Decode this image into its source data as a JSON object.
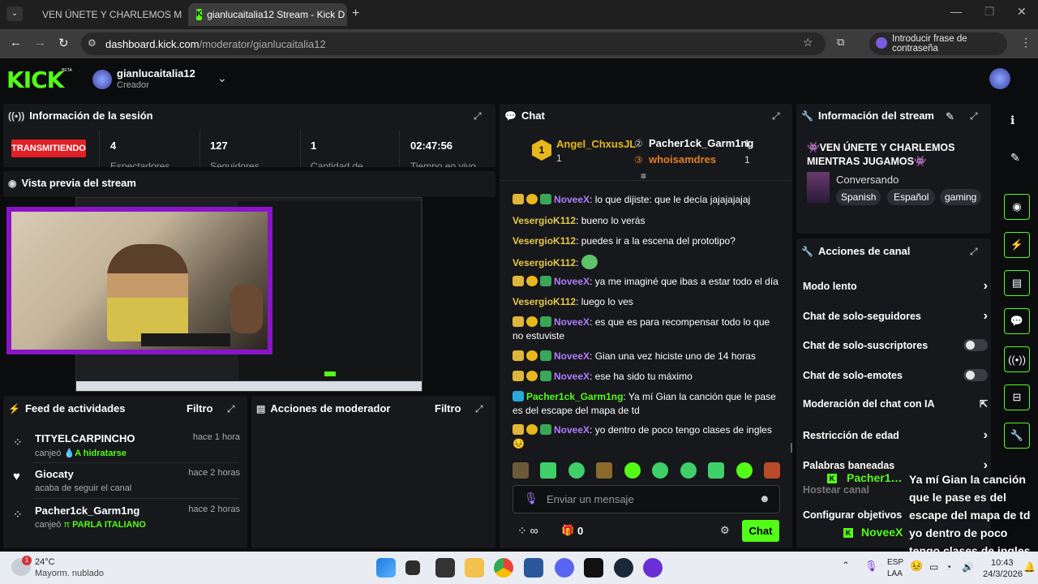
{
  "browser": {
    "tabs": [
      {
        "title": "VEN ÚNETE Y CHARLEMOS M"
      },
      {
        "title": "gianlucaitalia12 Stream - Kick D"
      }
    ],
    "url_domain": "dashboard.kick.com",
    "url_path": "/moderator/gianlucaitalia12",
    "profile_pill": "Introducir frase de contraseña"
  },
  "header": {
    "logo": "KICK",
    "beta": "BETA",
    "channel_name": "gianlucaitalia12",
    "role": "Creador"
  },
  "session": {
    "title": "Información de la sesión",
    "status": "TRANSMITIENDO",
    "stats": [
      {
        "value": "4",
        "label": "Espectadores"
      },
      {
        "value": "127",
        "label": "Seguidores"
      },
      {
        "value": "1",
        "label": "Cantidad de"
      },
      {
        "value": "02:47:56",
        "label": "Tiempo en vivo"
      }
    ]
  },
  "preview": {
    "title": "Vista previa del stream"
  },
  "feed": {
    "title": "Feed de actividades",
    "filter": "Filtro",
    "items": [
      {
        "name": "TITYELCARPINCHO",
        "time": "hace 1 hora",
        "sub_prefix": "canjeó",
        "reward": "A hidratarse"
      },
      {
        "name": "Giocaty",
        "time": "hace 2 horas",
        "sub_prefix": "acaba de seguir el canal",
        "reward": ""
      },
      {
        "name": "Pacher1ck_Garm1ng",
        "time": "hace 2 horas",
        "sub_prefix": "canjeó",
        "reward": "PARLA ITALIANO"
      }
    ]
  },
  "modactions": {
    "title": "Acciones de moderador",
    "filter": "Filtro"
  },
  "chat": {
    "title": "Chat",
    "leaders": [
      {
        "name": "Angel_ChxusJL",
        "count": "1"
      },
      {
        "name": "Pacher1ck_Garm1ng",
        "count": "1"
      },
      {
        "name": "whoisamdres",
        "count": "1"
      }
    ],
    "messages": [
      {
        "user": "NoveeX",
        "text": "lo que dijiste: que le decía jajajajajaj",
        "color": "#b07cff"
      },
      {
        "user": "VesergioK112",
        "text": "bueno lo verás",
        "color": "#e7c94a"
      },
      {
        "user": "VesergioK112",
        "text": "puedes ir a la escena del prototipo?",
        "color": "#e7c94a"
      },
      {
        "user": "VesergioK112",
        "text": "",
        "color": "#e7c94a"
      },
      {
        "user": "NoveeX",
        "text": "ya me imaginé que ibas a estar todo el día",
        "color": "#b07cff"
      },
      {
        "user": "VesergioK112",
        "text": "luego lo ves",
        "color": "#e7c94a"
      },
      {
        "user": "NoveeX",
        "text": "es que es para recompensar todo lo que no estuviste",
        "color": "#b07cff"
      },
      {
        "user": "NoveeX",
        "text": "Gian una vez hiciste uno de 14 horas",
        "color": "#b07cff"
      },
      {
        "user": "NoveeX",
        "text": "ese ha sido tu máximo",
        "color": "#b07cff"
      },
      {
        "user": "Pacher1ck_Garm1ng",
        "text": "Ya mí Gian la canción que le pase es del escape del mapa de td",
        "color": "#53fc18"
      },
      {
        "user": "NoveeX",
        "text": "yo dentro de poco tengo clases de ingles",
        "color": "#b07cff"
      }
    ],
    "input_placeholder": "Enviar un mensaje",
    "points": "0",
    "send_label": "Chat"
  },
  "streaminfo": {
    "title": "Información del stream",
    "stream_title": "👾VEN ÚNETE Y CHARLEMOS MIENTRAS JUGAMOS👾",
    "category": "Conversando",
    "tags": [
      "Spanish",
      "Español",
      "gaming"
    ]
  },
  "channel_actions": {
    "title": "Acciones de canal",
    "items": [
      {
        "label": "Modo lento"
      },
      {
        "label": "Chat de solo-seguidores"
      },
      {
        "label": "Chat de solo-suscriptores"
      },
      {
        "label": "Chat de solo-emotes"
      },
      {
        "label": "Moderación del chat con IA"
      },
      {
        "label": "Restricción de edad"
      },
      {
        "label": "Palabras baneadas"
      },
      {
        "label": "Hostear canal"
      },
      {
        "label": "Configurar objetivos"
      }
    ]
  },
  "overlay": {
    "user1": "Pacher1…",
    "text": "Ya mí Gian la canción que le pase es del escape del mapa de td yo dentro de poco tengo clases de ingles",
    "user2": "NoveeX"
  },
  "taskbar": {
    "weather_temp": "24°C",
    "weather_desc": "Mayorm. nublado",
    "weather_badge": "1",
    "lang1": "ESP",
    "lang2": "LAA",
    "time": "10:43",
    "date": "24/3/2026"
  },
  "colors": {
    "accent": "#53fc18",
    "live": "#e01f26",
    "bg": "#0b0c0e",
    "panel": "#17181b"
  }
}
